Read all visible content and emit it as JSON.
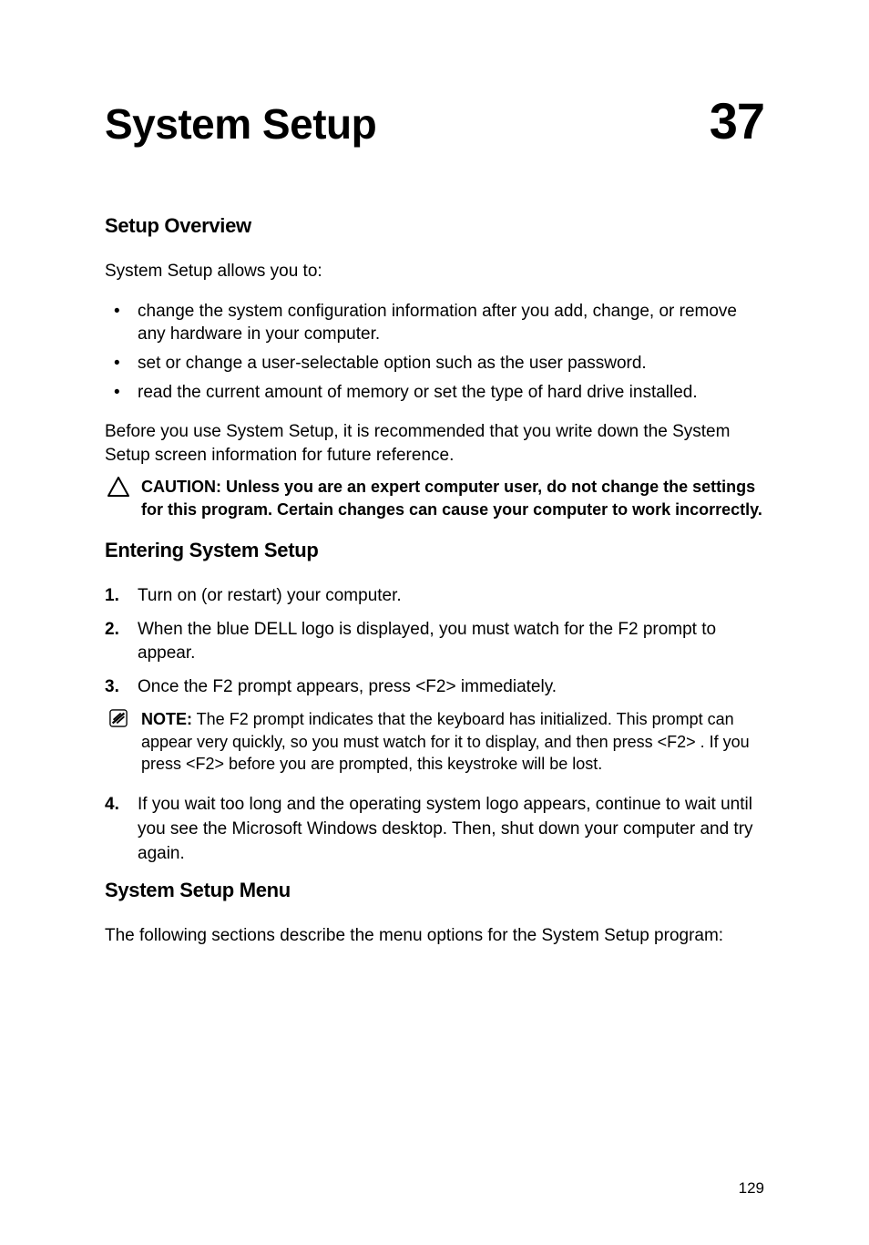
{
  "chapter": {
    "title": "System Setup",
    "number": "37"
  },
  "sections": {
    "overview": {
      "heading": "Setup Overview",
      "intro": "System Setup allows you to:",
      "bullets": [
        "change the system configuration information after you add, change, or remove any hardware in your computer.",
        "set or change a user-selectable option such as the user password.",
        "read the current amount of memory or set the type of hard drive installed."
      ],
      "afterText": "Before you use System Setup, it is recommended that you write down the System Setup screen information for future reference.",
      "caution": "CAUTION: Unless you are an expert computer user, do not change the settings for this program. Certain changes can cause your computer to work incorrectly."
    },
    "entering": {
      "heading": "Entering System Setup",
      "steps1": [
        "Turn on (or restart) your computer.",
        "When the blue DELL logo is displayed, you must watch for the F2 prompt to appear.",
        "Once the F2 prompt appears, press <F2> immediately."
      ],
      "noteLead": "NOTE:",
      "noteBody": " The F2 prompt indicates that the keyboard has initialized. This prompt can appear very quickly, so you must watch for it to display, and then press <F2> . If you press <F2> before you are prompted, this keystroke will be lost.",
      "steps2": [
        "If you wait too long and the operating system logo appears, continue to wait until you see the Microsoft Windows desktop. Then, shut down your computer and try again."
      ]
    },
    "menu": {
      "heading": "System Setup Menu",
      "intro": "The following sections describe the menu options for the System Setup program:"
    }
  },
  "pageNumber": "129"
}
